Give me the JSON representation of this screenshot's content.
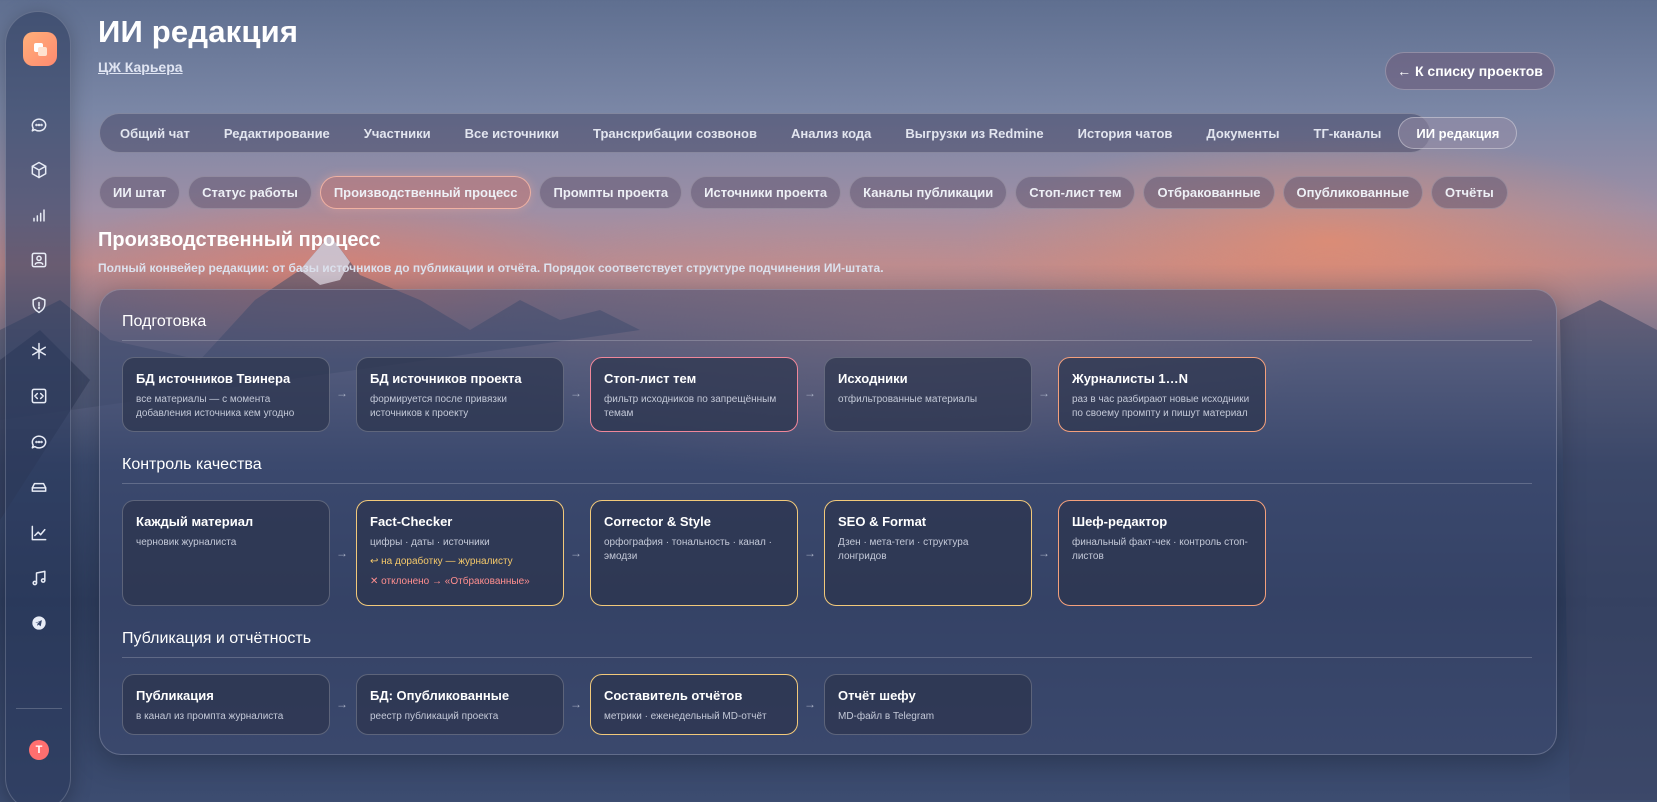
{
  "header": {
    "title": "ИИ редакция",
    "breadcrumb": "ЦЖ Карьера",
    "back_button": "← К списку проектов"
  },
  "sidebar": {
    "items": [
      {
        "icon": "chat-icon"
      },
      {
        "icon": "cube-icon"
      },
      {
        "icon": "signal-bars-icon"
      },
      {
        "icon": "contact-card-icon"
      },
      {
        "icon": "shield-icon"
      },
      {
        "icon": "asterisk-icon"
      },
      {
        "icon": "code-icon"
      },
      {
        "icon": "chat-dots-icon"
      },
      {
        "icon": "drive-icon"
      },
      {
        "icon": "trend-chart-icon"
      },
      {
        "icon": "music-note-icon"
      },
      {
        "icon": "telegram-icon"
      }
    ],
    "avatar": "T"
  },
  "tabs": [
    {
      "label": "Общий чат"
    },
    {
      "label": "Редактирование"
    },
    {
      "label": "Участники"
    },
    {
      "label": "Все источники"
    },
    {
      "label": "Транскрибации созвонов"
    },
    {
      "label": "Анализ кода"
    },
    {
      "label": "Выгрузки из Redmine"
    },
    {
      "label": "История чатов"
    },
    {
      "label": "Документы"
    },
    {
      "label": "ТГ-каналы"
    },
    {
      "label": "ИИ редакция",
      "active": true
    }
  ],
  "subtabs": [
    {
      "label": "ИИ штат"
    },
    {
      "label": "Статус работы"
    },
    {
      "label": "Производственный процесс",
      "active": true
    },
    {
      "label": "Промпты проекта"
    },
    {
      "label": "Источники проекта"
    },
    {
      "label": "Каналы публикации"
    },
    {
      "label": "Стоп-лист тем"
    },
    {
      "label": "Отбракованные"
    },
    {
      "label": "Опубликованные"
    },
    {
      "label": "Отчёты"
    }
  ],
  "page": {
    "heading": "Производственный процесс",
    "description": "Полный конвейер редакции: от базы источников до публикации и отчёта. Порядок соответствует структуре подчинения ИИ-штата."
  },
  "sections": [
    {
      "title": "Подготовка",
      "cards": [
        {
          "title": "БД источников Твинера",
          "desc": "все материалы — с момента добавления источника кем угодно"
        },
        {
          "title": "БД источников проекта",
          "desc": "формируется после привязки источников к проекту"
        },
        {
          "title": "Стоп-лист тем",
          "desc": "фильтр исходников по запрещённым темам",
          "accent": "red"
        },
        {
          "title": "Исходники",
          "desc": "отфильтрованные материалы"
        },
        {
          "title": "Журналисты 1…N",
          "desc": "раз в час разбирают новые исходники по своему промпту и пишут материал",
          "accent": "orange"
        }
      ]
    },
    {
      "title": "Контроль качества",
      "cards": [
        {
          "title": "Каждый материал",
          "desc": "черновик журналиста"
        },
        {
          "title": "Fact-Checker",
          "desc": "цифры · даты · источники",
          "note1": "↩ на доработку — журналисту",
          "note2": "✕ отклонено → «Отбракованные»",
          "accent": "yellow"
        },
        {
          "title": "Corrector & Style",
          "desc": "орфография · тональность · канал · эмодзи",
          "accent": "yellow"
        },
        {
          "title": "SEO & Format",
          "desc": "Дзен · мета-теги · структура лонгридов",
          "accent": "yellow"
        },
        {
          "title": "Шеф-редактор",
          "desc": "финальный факт-чек · контроль стоп-листов",
          "accent": "orange"
        }
      ]
    },
    {
      "title": "Публикация и отчётность",
      "cards": [
        {
          "title": "Публикация",
          "desc": "в канал из промпта журналиста"
        },
        {
          "title": "БД: Опубликованные",
          "desc": "реестр публикаций проекта"
        },
        {
          "title": "Составитель отчётов",
          "desc": "метрики · еженедельный MD-отчёт",
          "accent": "yellow"
        },
        {
          "title": "Отчёт шефу",
          "desc": "MD-файл в Telegram"
        }
      ]
    }
  ],
  "arrow": "→"
}
